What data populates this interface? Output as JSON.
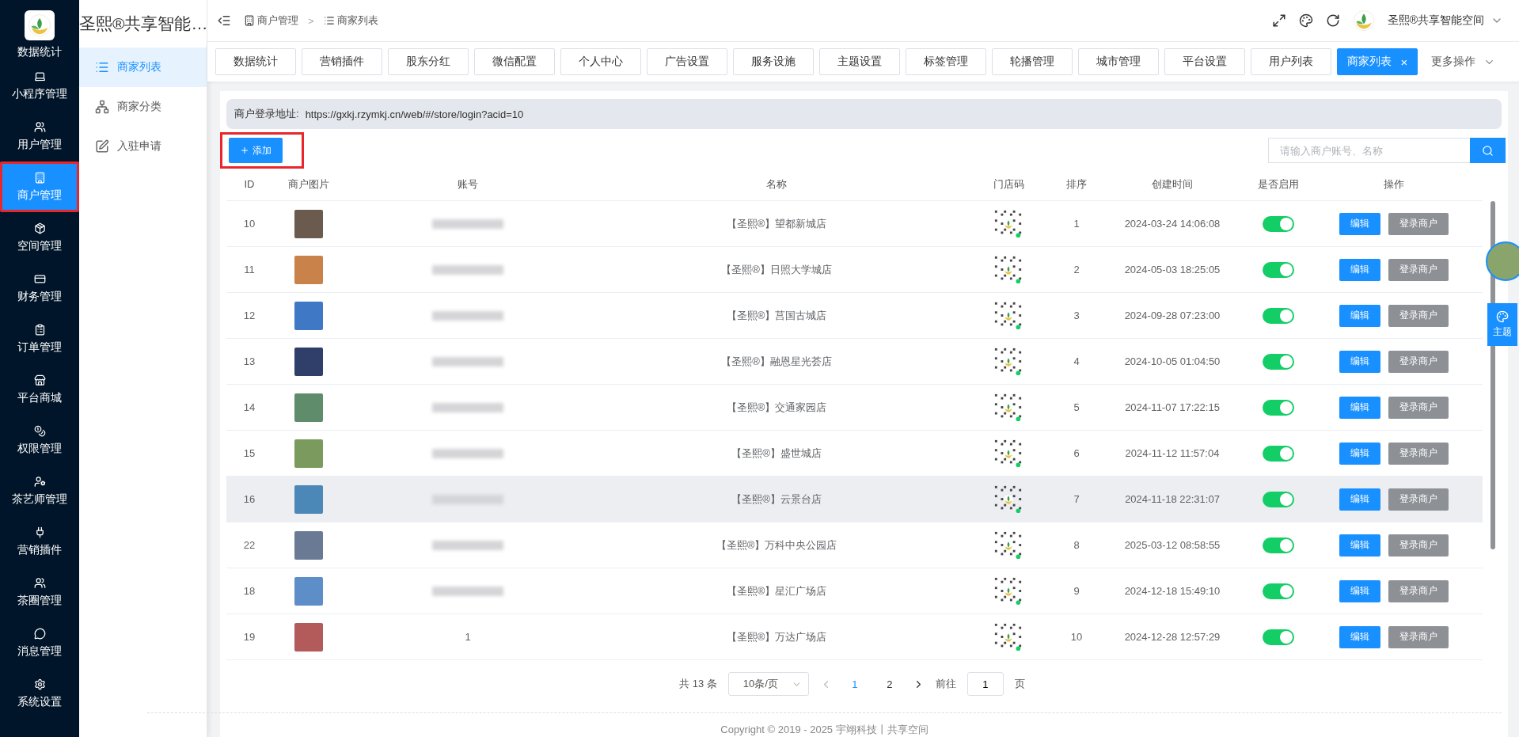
{
  "sidebar": {
    "items": [
      {
        "label": "数据统计",
        "selected": false,
        "annotated": false
      },
      {
        "label": "小程序管理",
        "selected": false,
        "annotated": false
      },
      {
        "label": "用户管理",
        "selected": false,
        "annotated": false
      },
      {
        "label": "商户管理",
        "selected": true,
        "annotated": true
      },
      {
        "label": "空间管理",
        "selected": false,
        "annotated": false
      },
      {
        "label": "财务管理",
        "selected": false,
        "annotated": false
      },
      {
        "label": "订单管理",
        "selected": false,
        "annotated": false
      },
      {
        "label": "平台商城",
        "selected": false,
        "annotated": false
      },
      {
        "label": "权限管理",
        "selected": false,
        "annotated": false
      },
      {
        "label": "茶艺师管理",
        "selected": false,
        "annotated": false
      },
      {
        "label": "营销插件",
        "selected": false,
        "annotated": false
      },
      {
        "label": "茶圈管理",
        "selected": false,
        "annotated": false
      },
      {
        "label": "消息管理",
        "selected": false,
        "annotated": false
      },
      {
        "label": "系统设置",
        "selected": false,
        "annotated": false
      }
    ]
  },
  "submenu": {
    "title": "圣熙®共享智能…",
    "items": [
      {
        "label": "商家列表",
        "selected": true
      },
      {
        "label": "商家分类",
        "selected": false
      },
      {
        "label": "入驻申请",
        "selected": false
      }
    ]
  },
  "breadcrumb": [
    "商户管理",
    "商家列表"
  ],
  "breadcrumb_separator": ">",
  "user": {
    "name": "圣熙®共享智能空间"
  },
  "tabs": [
    {
      "label": "数据统计",
      "selected": false
    },
    {
      "label": "营销插件",
      "selected": false
    },
    {
      "label": "股东分红",
      "selected": false
    },
    {
      "label": "微信配置",
      "selected": false
    },
    {
      "label": "个人中心",
      "selected": false
    },
    {
      "label": "广告设置",
      "selected": false
    },
    {
      "label": "服务设施",
      "selected": false
    },
    {
      "label": "主题设置",
      "selected": false
    },
    {
      "label": "标签管理",
      "selected": false
    },
    {
      "label": "轮播管理",
      "selected": false
    },
    {
      "label": "城市管理",
      "selected": false
    },
    {
      "label": "平台设置",
      "selected": false
    },
    {
      "label": "用户列表",
      "selected": false
    },
    {
      "label": "商家列表",
      "selected": true,
      "close": "×"
    }
  ],
  "more_tabs": "更多操作",
  "login_address": {
    "label": "商户登录地址:",
    "url": "https://gxkj.rzymkj.cn/web/#/store/login?acid=10"
  },
  "add_button": {
    "label": "添加",
    "annotated": true
  },
  "search": {
    "placeholder": "请输入商户账号、名称"
  },
  "table": {
    "columns": [
      "ID",
      "商户图片",
      "账号",
      "名称",
      "门店码",
      "排序",
      "创建时间",
      "是否启用",
      "操作"
    ],
    "rows": [
      {
        "id": "10",
        "name": "【圣熙®】望都新城店",
        "sort": "1",
        "created": "2024-03-24 14:06:08",
        "enabled": true,
        "highlighted": false,
        "actions": [
          "编辑",
          "登录商户"
        ]
      },
      {
        "id": "11",
        "name": "【圣熙®】日照大学城店",
        "sort": "2",
        "created": "2024-05-03 18:25:05",
        "enabled": true,
        "highlighted": false,
        "actions": [
          "编辑",
          "登录商户"
        ]
      },
      {
        "id": "12",
        "name": "【圣熙®】莒国古城店",
        "sort": "3",
        "created": "2024-09-28 07:23:00",
        "enabled": true,
        "highlighted": false,
        "actions": [
          "编辑",
          "登录商户"
        ]
      },
      {
        "id": "13",
        "name": "【圣熙®】融恩星光荟店",
        "sort": "4",
        "created": "2024-10-05 01:04:50",
        "enabled": true,
        "highlighted": false,
        "actions": [
          "编辑",
          "登录商户"
        ]
      },
      {
        "id": "14",
        "name": "【圣熙®】交通家园店",
        "sort": "5",
        "created": "2024-11-07 17:22:15",
        "enabled": true,
        "highlighted": false,
        "actions": [
          "编辑",
          "登录商户"
        ]
      },
      {
        "id": "15",
        "name": "【圣熙®】盛世城店",
        "sort": "6",
        "created": "2024-11-12 11:57:04",
        "enabled": true,
        "highlighted": false,
        "actions": [
          "编辑",
          "登录商户"
        ]
      },
      {
        "id": "16",
        "name": "【圣熙®】云景台店",
        "sort": "7",
        "created": "2024-11-18 22:31:07",
        "enabled": true,
        "highlighted": true,
        "actions": [
          "编辑",
          "登录商户"
        ]
      },
      {
        "id": "22",
        "name": "【圣熙®】万科中央公园店",
        "sort": "8",
        "created": "2025-03-12 08:58:55",
        "enabled": true,
        "highlighted": false,
        "actions": [
          "编辑",
          "登录商户"
        ]
      },
      {
        "id": "18",
        "name": "【圣熙®】星汇广场店",
        "sort": "9",
        "created": "2024-12-18 15:49:10",
        "enabled": true,
        "highlighted": false,
        "actions": [
          "编辑",
          "登录商户"
        ]
      },
      {
        "id": "19",
        "account": "1",
        "name": "【圣熙®】万达广场店",
        "sort": "10",
        "created": "2024-12-28 12:57:29",
        "enabled": true,
        "highlighted": false,
        "actions": [
          "编辑",
          "登录商户"
        ]
      }
    ]
  },
  "pagination": {
    "total": "共 13 条",
    "page_size": "10条/页",
    "pages": [
      {
        "label": "1",
        "selected": true
      },
      {
        "label": "2",
        "selected": false
      }
    ],
    "goto_label": "前往",
    "goto_value": "1",
    "goto_suffix": "页"
  },
  "footer": "Copyright © 2019 - 2025 宇翊科技丨共享空间",
  "theme_button": "主题"
}
